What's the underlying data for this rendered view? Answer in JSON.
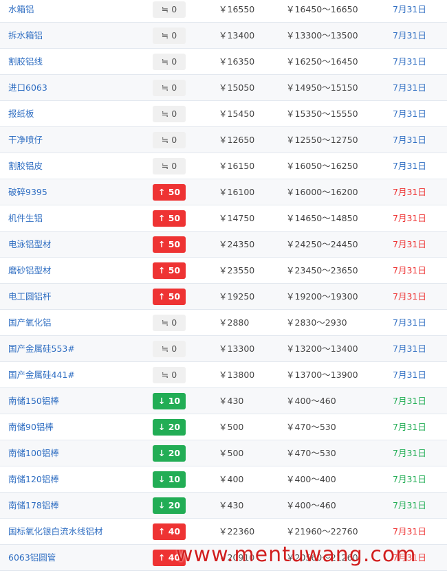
{
  "colors": {
    "name": "#2f6ec2",
    "up": "#ee3333",
    "down": "#22ad55",
    "flat": "#f0f0f0"
  },
  "icons": {
    "up": "arrow-up-icon",
    "down": "arrow-down-icon",
    "flat": "approx-equal-icon"
  },
  "rows": [
    {
      "name": "水箱铝",
      "dir": "flat",
      "change": "≒ 0",
      "price": "￥16550",
      "range": "￥16450～16650",
      "date": "7月31日"
    },
    {
      "name": "拆水箱铝",
      "dir": "flat",
      "change": "≒ 0",
      "price": "￥13400",
      "range": "￥13300～13500",
      "date": "7月31日"
    },
    {
      "name": "割胶铝线",
      "dir": "flat",
      "change": "≒ 0",
      "price": "￥16350",
      "range": "￥16250～16450",
      "date": "7月31日"
    },
    {
      "name": "进口6063",
      "dir": "flat",
      "change": "≒ 0",
      "price": "￥15050",
      "range": "￥14950～15150",
      "date": "7月31日"
    },
    {
      "name": "报纸板",
      "dir": "flat",
      "change": "≒ 0",
      "price": "￥15450",
      "range": "￥15350～15550",
      "date": "7月31日"
    },
    {
      "name": "干净喷仔",
      "dir": "flat",
      "change": "≒ 0",
      "price": "￥12650",
      "range": "￥12550～12750",
      "date": "7月31日"
    },
    {
      "name": "割胶铝皮",
      "dir": "flat",
      "change": "≒ 0",
      "price": "￥16150",
      "range": "￥16050～16250",
      "date": "7月31日"
    },
    {
      "name": "破碎9395",
      "dir": "up",
      "change": "↑ 50",
      "price": "￥16100",
      "range": "￥16000～16200",
      "date": "7月31日"
    },
    {
      "name": "机件生铝",
      "dir": "up",
      "change": "↑ 50",
      "price": "￥14750",
      "range": "￥14650～14850",
      "date": "7月31日"
    },
    {
      "name": "电泳铝型材",
      "dir": "up",
      "change": "↑ 50",
      "price": "￥24350",
      "range": "￥24250～24450",
      "date": "7月31日"
    },
    {
      "name": "磨砂铝型材",
      "dir": "up",
      "change": "↑ 50",
      "price": "￥23550",
      "range": "￥23450～23650",
      "date": "7月31日"
    },
    {
      "name": "电工圆铝杆",
      "dir": "up",
      "change": "↑ 50",
      "price": "￥19250",
      "range": "￥19200～19300",
      "date": "7月31日"
    },
    {
      "name": "国产氧化铝",
      "dir": "flat",
      "change": "≒ 0",
      "price": "￥2880",
      "range": "￥2830～2930",
      "date": "7月31日"
    },
    {
      "name": "国产金属硅553#",
      "dir": "flat",
      "change": "≒ 0",
      "price": "￥13300",
      "range": "￥13200～13400",
      "date": "7月31日"
    },
    {
      "name": "国产金属硅441#",
      "dir": "flat",
      "change": "≒ 0",
      "price": "￥13800",
      "range": "￥13700～13900",
      "date": "7月31日"
    },
    {
      "name": "南储150铝棒",
      "dir": "down",
      "change": "↓ 10",
      "price": "￥430",
      "range": "￥400～460",
      "date": "7月31日"
    },
    {
      "name": "南储90铝棒",
      "dir": "down",
      "change": "↓ 20",
      "price": "￥500",
      "range": "￥470～530",
      "date": "7月31日"
    },
    {
      "name": "南储100铝棒",
      "dir": "down",
      "change": "↓ 20",
      "price": "￥500",
      "range": "￥470～530",
      "date": "7月31日"
    },
    {
      "name": "南储120铝棒",
      "dir": "down",
      "change": "↓ 10",
      "price": "￥400",
      "range": "￥400～400",
      "date": "7月31日"
    },
    {
      "name": "南储178铝棒",
      "dir": "down",
      "change": "↓ 20",
      "price": "￥430",
      "range": "￥400～460",
      "date": "7月31日"
    },
    {
      "name": "国标氧化银白流水线铝材",
      "dir": "up",
      "change": "↑ 40",
      "price": "￥22360",
      "range": "￥21960～22760",
      "date": "7月31日"
    },
    {
      "name": "6063铝圆管",
      "dir": "up",
      "change": "↑ 40",
      "price": "￥20910",
      "range": "￥20560～21260",
      "date": "7月31日"
    }
  ],
  "watermark": "www.mentuwang.com"
}
